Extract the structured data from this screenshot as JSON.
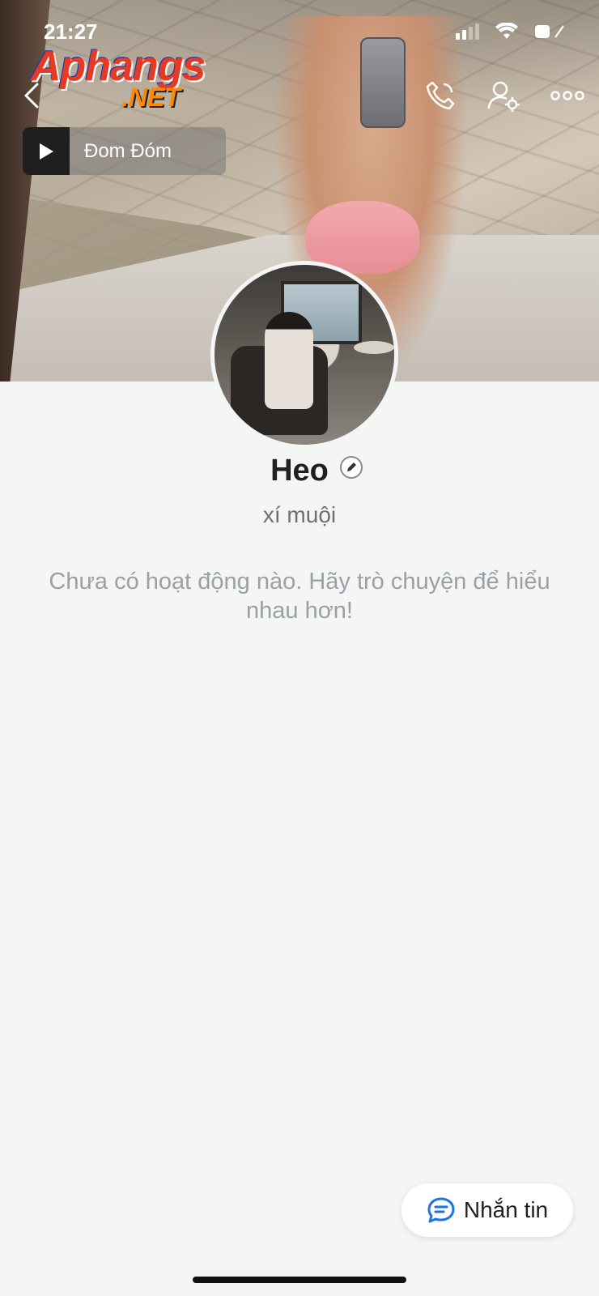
{
  "status_bar": {
    "time": "21:27"
  },
  "watermark": {
    "brand": "Aphangs",
    "suffix": ".NET"
  },
  "header": {
    "back_icon": "chevron-left-icon",
    "call_icon": "phone-icon",
    "settings_icon": "user-settings-icon",
    "more_icon": "more-dots-icon"
  },
  "music": {
    "title": "Đom Đóm"
  },
  "profile": {
    "name": "Heo",
    "bio": "xí muội",
    "empty_message": "Chưa có hoạt động nào. Hãy trò chuyện để hiểu nhau hơn!"
  },
  "actions": {
    "message_label": "Nhắn tin"
  },
  "colors": {
    "background": "#f4f5f5",
    "accent": "#1a73e8",
    "muted_text": "#9aa0a6"
  }
}
